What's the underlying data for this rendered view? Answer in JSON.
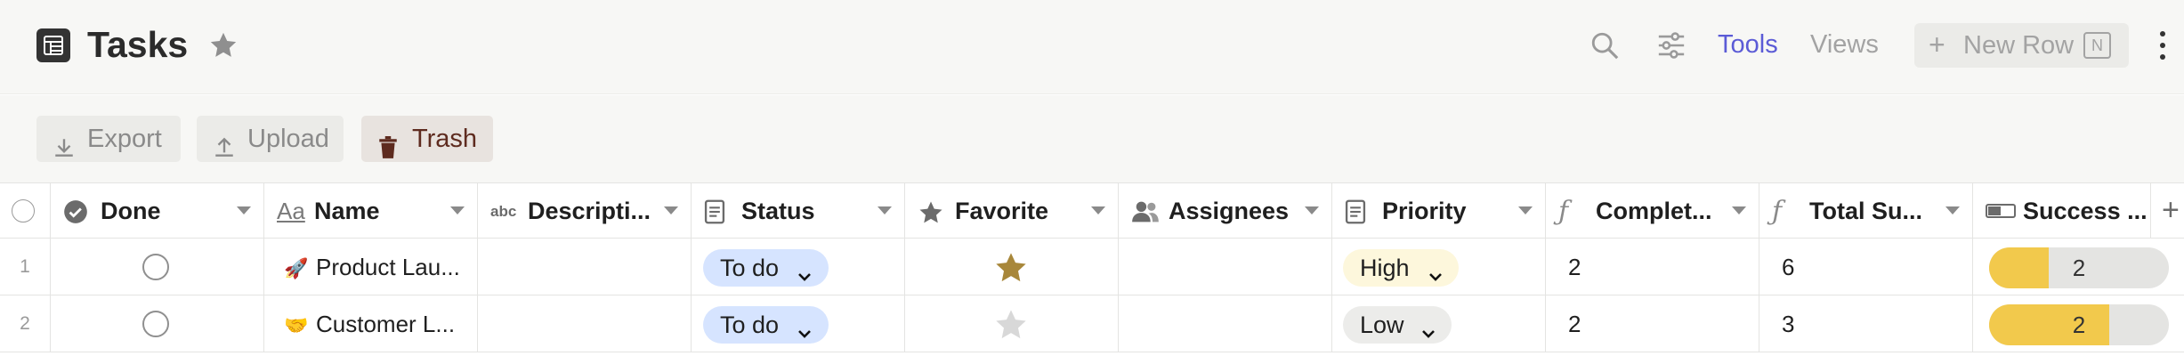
{
  "header": {
    "title": "Tasks",
    "tools_label": "Tools",
    "views_label": "Views",
    "new_row_label": "New Row",
    "new_row_shortcut": "N",
    "icons": [
      "table-icon",
      "star-icon",
      "search-icon",
      "filter-icon",
      "more-icon"
    ]
  },
  "toolbar": {
    "export_label": "Export",
    "upload_label": "Upload",
    "trash_label": "Trash"
  },
  "columns": [
    {
      "label": "Done",
      "icon": "checkbox-icon"
    },
    {
      "label": "Name",
      "icon": "text-aa-icon"
    },
    {
      "label": "Descripti...",
      "icon": "abc-icon"
    },
    {
      "label": "Status",
      "icon": "document-icon"
    },
    {
      "label": "Favorite",
      "icon": "star-icon"
    },
    {
      "label": "Assignees",
      "icon": "people-icon"
    },
    {
      "label": "Priority",
      "icon": "document-icon"
    },
    {
      "label": "Complet...",
      "icon": "formula-icon"
    },
    {
      "label": "Total Su...",
      "icon": "formula-icon"
    },
    {
      "label": "Success ...",
      "icon": "progress-icon"
    }
  ],
  "rows": [
    {
      "index": "1",
      "done": false,
      "emoji": "🚀",
      "name": "Product Lau...",
      "description": "",
      "status": "To do",
      "favorite": true,
      "assignees": "",
      "priority": "High",
      "completed": "2",
      "total": "6",
      "success_value": "2",
      "success_fraction": 0.333
    },
    {
      "index": "2",
      "done": false,
      "emoji": "🤝",
      "name": "Customer L...",
      "description": "",
      "status": "To do",
      "favorite": false,
      "assignees": "",
      "priority": "Low",
      "completed": "2",
      "total": "3",
      "success_value": "2",
      "success_fraction": 0.667
    }
  ],
  "colors": {
    "accent": "#5b5bd6",
    "status_todo_bg": "#d6e4ff",
    "priority_high_bg": "#fdf7dc",
    "priority_low_bg": "#ececea",
    "favorite_on": "#a8873a",
    "favorite_off": "#d8d8d8",
    "progress_fill": "#f2c94c",
    "trash_text": "#5e2b1f"
  }
}
